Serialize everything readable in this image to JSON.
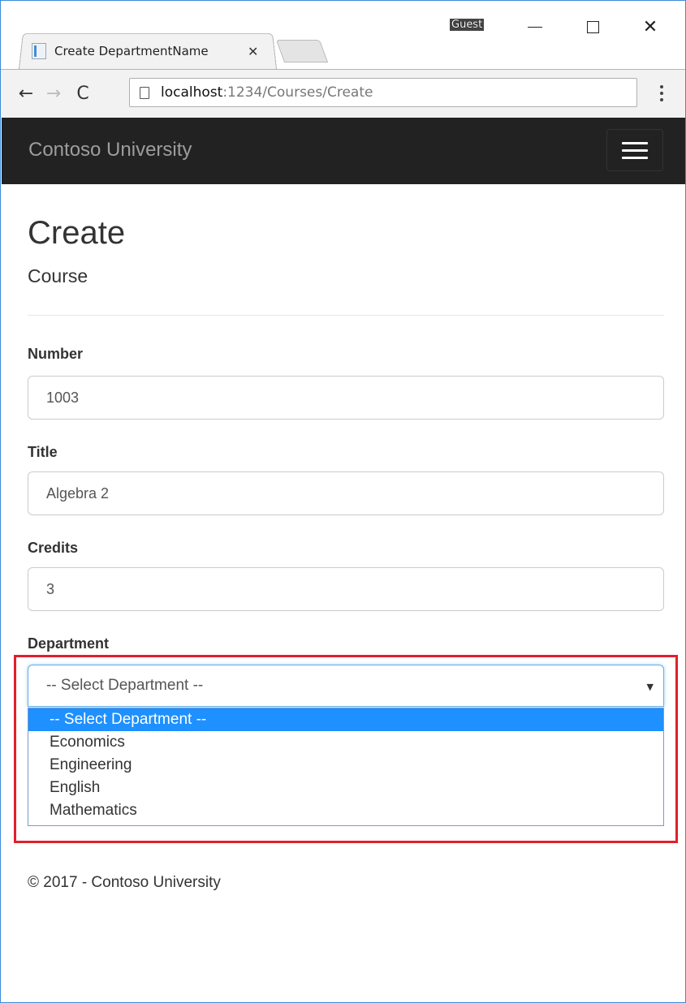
{
  "browser": {
    "tab_title": "Create DepartmentName",
    "tab_close": "✕",
    "profile": "Guest",
    "url_host": "localhost",
    "url_rest": ":1234/Courses/Create"
  },
  "navbar": {
    "brand": "Contoso University",
    "background": "#222222"
  },
  "page": {
    "title": "Create",
    "subtitle": "Course"
  },
  "form": {
    "number": {
      "label": "Number",
      "value": "1003"
    },
    "title": {
      "label": "Title",
      "value": "Algebra 2"
    },
    "credits": {
      "label": "Credits",
      "value": "3"
    },
    "department": {
      "label": "Department",
      "selected": "-- Select Department --",
      "options": [
        "-- Select Department --",
        "Economics",
        "Engineering",
        "English",
        "Mathematics"
      ]
    }
  },
  "footer": {
    "text": "© 2017 - Contoso University"
  },
  "colors": {
    "highlight": "#e0202b",
    "selected_option": "#1e90ff",
    "focus": "#66afe9"
  }
}
